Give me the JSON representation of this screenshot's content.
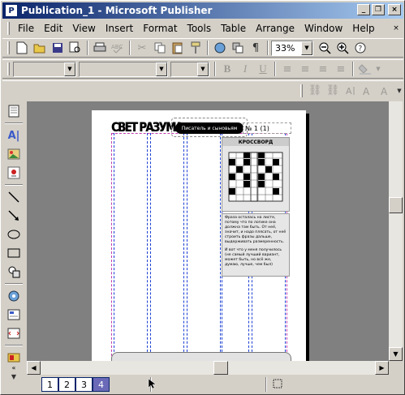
{
  "window": {
    "title": "Publication_1 - Microsoft Publisher",
    "app_icon": "P",
    "minimize": "_",
    "restore": "❐",
    "close": "×"
  },
  "menu": {
    "items": [
      "File",
      "Edit",
      "View",
      "Insert",
      "Format",
      "Tools",
      "Table",
      "Arrange",
      "Window",
      "Help"
    ],
    "close_doc": "×"
  },
  "toolbar": {
    "zoom_value": "33%"
  },
  "document": {
    "masthead_title": "СВЕТ РАЗУМА",
    "pill_text": "Писатель и сыновьям",
    "issue_number": "№ 1 (1)",
    "crossword_title": "КРОССВОРД",
    "paragraph_1": "Фраза осталась на листе, потому что по логике она должна там быть. От неё, значит, и надо плясать, от неё строить фразы дальше, выдерживать размеренность.",
    "paragraph_2": "И вот что у меня получилось (не самый лучший вариант, может быть, но всё же, думаю, лучше, чем был)"
  },
  "pages": {
    "tabs": [
      "1",
      "2",
      "3",
      "4"
    ],
    "active": "4"
  },
  "colors": {
    "titlebar_start": "#0a246a",
    "titlebar_end": "#a6caf0",
    "workspace": "#808080",
    "column_guides": "#1a3fd4",
    "margin_guides": "#c23bb0"
  }
}
